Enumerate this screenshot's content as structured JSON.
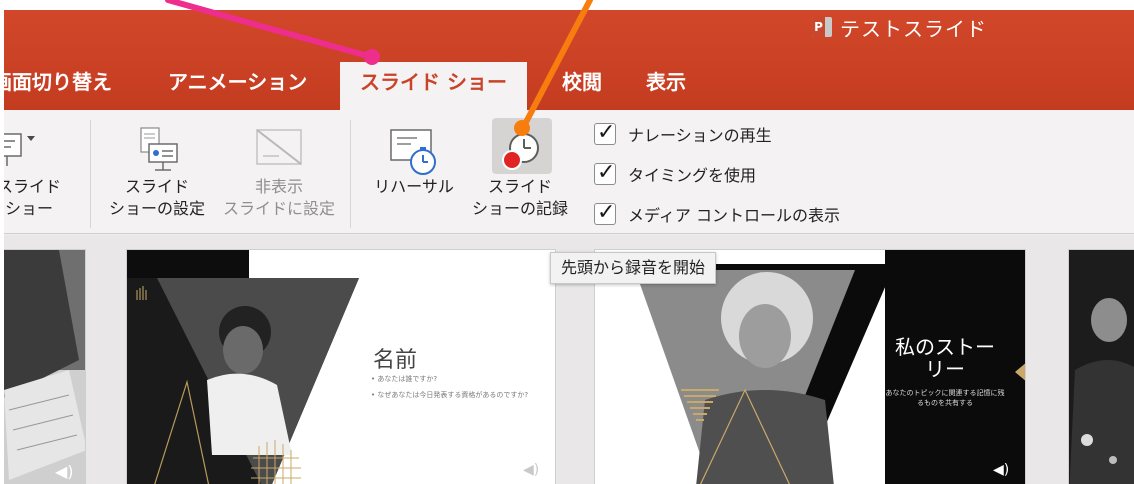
{
  "window": {
    "title": "テストスライド"
  },
  "tabs": [
    {
      "label": "画面切り替え"
    },
    {
      "label": "アニメーション"
    },
    {
      "label": "スライド ショー",
      "active": true
    },
    {
      "label": "校閲"
    },
    {
      "label": "表示"
    }
  ],
  "ribbon": {
    "from_start_label": "スライド\nショー",
    "setup_label": "スライド\nショーの設定",
    "hide_label": "非表示\nスライドに設定",
    "rehearse_label": "リハーサル",
    "record_label": "スライド\nショーの記録",
    "checkboxes": [
      {
        "label": "ナレーションの再生",
        "checked": true
      },
      {
        "label": "タイミングを使用",
        "checked": true
      },
      {
        "label": "メディア コントロールの表示",
        "checked": true
      }
    ]
  },
  "tooltip": {
    "text": "先頭から録音を開始"
  },
  "slides": [
    {
      "title": "名前",
      "bullets": [
        "あなたは誰ですか?",
        "なぜあなたは今日発表する資格があるのですか?"
      ]
    },
    {
      "title": "私のストーリー",
      "subtitle": "あなたのトピックに関連する記憶に残るものを共有する"
    }
  ],
  "colors": {
    "titlebar": "#c9432a",
    "annotation_pink": "#ee2d8c",
    "annotation_orange": "#f77d0e"
  }
}
